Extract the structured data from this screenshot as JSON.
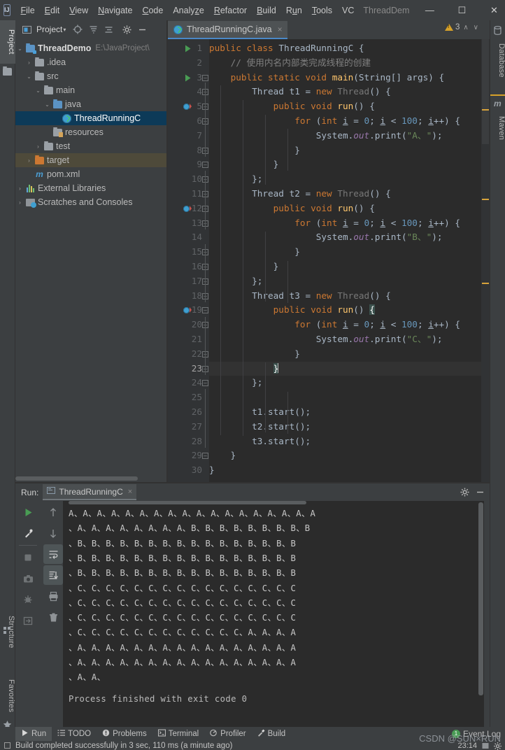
{
  "window": {
    "logo": "IJ",
    "project_label": "ThreadDem",
    "minimize": "—",
    "maximize": "☐",
    "close": "✕"
  },
  "menubar": {
    "items": [
      {
        "pre": "",
        "u": "F",
        "post": "ile"
      },
      {
        "pre": "",
        "u": "E",
        "post": "dit"
      },
      {
        "pre": "",
        "u": "V",
        "post": "iew"
      },
      {
        "pre": "",
        "u": "N",
        "post": "avigate"
      },
      {
        "pre": "",
        "u": "C",
        "post": "ode"
      },
      {
        "pre": "Analy",
        "u": "z",
        "post": "e"
      },
      {
        "pre": "",
        "u": "R",
        "post": "efactor"
      },
      {
        "pre": "",
        "u": "B",
        "post": "uild"
      },
      {
        "pre": "R",
        "u": "u",
        "post": "n"
      },
      {
        "pre": "",
        "u": "T",
        "post": "ools"
      },
      {
        "pre": "VC",
        "u": "",
        "post": ""
      }
    ]
  },
  "left_strip": {
    "project_tab": "Project",
    "structure_tab": "Structure",
    "favorites_tab": "Favorites"
  },
  "right_strip": {
    "database_tab": "Database",
    "maven_tab": "Maven"
  },
  "project_panel": {
    "title": "Project",
    "icons": [
      "locate-icon",
      "collapse-all-icon",
      "expand-all-icon",
      "settings-gear-icon",
      "hide-panel-icon"
    ],
    "tree": [
      {
        "indent": 0,
        "arrow": "⌄",
        "icon": "module-folder-icon",
        "label": "ThreadDemo",
        "bold": true,
        "hint": "E:\\JavaProject\\",
        "state": "normal"
      },
      {
        "indent": 1,
        "arrow": "›",
        "icon": "folder-icon",
        "label": ".idea",
        "bold": false,
        "hint": "",
        "state": "normal"
      },
      {
        "indent": 1,
        "arrow": "⌄",
        "icon": "folder-icon",
        "label": "src",
        "bold": false,
        "hint": "",
        "state": "normal"
      },
      {
        "indent": 2,
        "arrow": "⌄",
        "icon": "folder-icon",
        "label": "main",
        "bold": false,
        "hint": "",
        "state": "normal"
      },
      {
        "indent": 3,
        "arrow": "⌄",
        "icon": "source-folder-icon",
        "label": "java",
        "bold": false,
        "hint": "",
        "state": "normal"
      },
      {
        "indent": 4,
        "arrow": "",
        "icon": "java-class-icon",
        "label": "ThreadRunningC",
        "bold": false,
        "hint": "",
        "state": "selected"
      },
      {
        "indent": 3,
        "arrow": "",
        "icon": "resources-folder-icon",
        "label": "resources",
        "bold": false,
        "hint": "",
        "state": "normal"
      },
      {
        "indent": 2,
        "arrow": "›",
        "icon": "folder-icon",
        "label": "test",
        "bold": false,
        "hint": "",
        "state": "normal"
      },
      {
        "indent": 1,
        "arrow": "›",
        "icon": "excluded-folder-icon",
        "label": "target",
        "bold": false,
        "hint": "",
        "state": "highlighted"
      },
      {
        "indent": 1,
        "arrow": "",
        "icon": "maven-pom-icon",
        "label": "pom.xml",
        "bold": false,
        "hint": "",
        "state": "normal"
      },
      {
        "indent": 0,
        "arrow": "›",
        "icon": "external-libraries-icon",
        "label": "External Libraries",
        "bold": false,
        "hint": "",
        "state": "normal"
      },
      {
        "indent": 0,
        "arrow": "›",
        "icon": "scratches-icon",
        "label": "Scratches and Consoles",
        "bold": false,
        "hint": "",
        "state": "normal"
      }
    ]
  },
  "editor": {
    "tab": {
      "label": "ThreadRunningC.java",
      "icon": "java-class-icon",
      "close": "×"
    },
    "inspection": {
      "count": "3",
      "icon": "warning-triangle-icon",
      "up": "∧",
      "down": "∨"
    },
    "cursor_line": 23,
    "lines": [
      {
        "n": 1,
        "html": "<span class=\"kw\">public class</span> <span class=\"typ\">ThreadRunningC</span> {",
        "gutter_run": true,
        "fold": "",
        "bp": false
      },
      {
        "n": 2,
        "html": "    <span class=\"cmt\">// 使用内名内部类完成线程的创建</span>",
        "gutter_run": false,
        "fold": "",
        "bp": false
      },
      {
        "n": 3,
        "html": "    <span class=\"kw\">public static</span> <span class=\"kw\">void</span> <span class=\"mth\">main</span>(String[] args) {",
        "gutter_run": true,
        "fold": "minus",
        "bp": false
      },
      {
        "n": 4,
        "html": "        Thread t1 = <span class=\"kw\">new</span> <span class=\"dim\">Thread</span>() {",
        "gutter_run": false,
        "fold": "minus",
        "bp": false
      },
      {
        "n": 5,
        "html": "            <span class=\"kw\">public</span> <span class=\"kw\">void</span> <span class=\"mth\">run</span>() {",
        "gutter_run": false,
        "fold": "minus",
        "bp": true
      },
      {
        "n": 6,
        "html": "                <span class=\"kw\">for</span> (<span class=\"kw\">int</span> <span class=\"var-u\">i</span> = <span class=\"num\">0</span>; <span class=\"var-u\">i</span> &lt; <span class=\"num\">100</span>; <span class=\"var-u\">i</span>++) {",
        "gutter_run": false,
        "fold": "minus",
        "bp": false
      },
      {
        "n": 7,
        "html": "                    System.<span class=\"fld\">out</span>.print(<span class=\"str\">\"A、\"</span>);",
        "gutter_run": false,
        "fold": "",
        "bp": false
      },
      {
        "n": 8,
        "html": "                }",
        "gutter_run": false,
        "fold": "end",
        "bp": false
      },
      {
        "n": 9,
        "html": "            }",
        "gutter_run": false,
        "fold": "minus",
        "bp": false
      },
      {
        "n": 10,
        "html": "        };",
        "gutter_run": false,
        "fold": "end",
        "bp": false
      },
      {
        "n": 11,
        "html": "        Thread t2 = <span class=\"kw\">new</span> <span class=\"dim\">Thread</span>() {",
        "gutter_run": false,
        "fold": "minus",
        "bp": false
      },
      {
        "n": 12,
        "html": "            <span class=\"kw\">public</span> <span class=\"kw\">void</span> <span class=\"mth\">run</span>() {",
        "gutter_run": false,
        "fold": "end",
        "bp": true
      },
      {
        "n": 13,
        "html": "                <span class=\"kw\">for</span> (<span class=\"kw\">int</span> <span class=\"var-u\">i</span> = <span class=\"num\">0</span>; <span class=\"var-u\">i</span> &lt; <span class=\"num\">100</span>; <span class=\"var-u\">i</span>++) {",
        "gutter_run": false,
        "fold": "minus",
        "bp": false
      },
      {
        "n": 14,
        "html": "                    System.<span class=\"fld\">out</span>.print(<span class=\"str\">\"B、\"</span>);",
        "gutter_run": false,
        "fold": "",
        "bp": false
      },
      {
        "n": 15,
        "html": "                }",
        "gutter_run": false,
        "fold": "end",
        "bp": false
      },
      {
        "n": 16,
        "html": "            }",
        "gutter_run": false,
        "fold": "minus",
        "bp": false
      },
      {
        "n": 17,
        "html": "        };",
        "gutter_run": false,
        "fold": "end",
        "bp": false
      },
      {
        "n": 18,
        "html": "        Thread t3 = <span class=\"kw\">new</span> <span class=\"dim\">Thread</span>() {",
        "gutter_run": false,
        "fold": "minus",
        "bp": false
      },
      {
        "n": 19,
        "html": "            <span class=\"kw\">public</span> <span class=\"kw\">void</span> <span class=\"mth\">run</span>() <span class=\"brace-hi\">{</span>",
        "gutter_run": false,
        "fold": "end",
        "bp": true
      },
      {
        "n": 20,
        "html": "                <span class=\"kw\">for</span> (<span class=\"kw\">int</span> <span class=\"var-u\">i</span> = <span class=\"num\">0</span>; <span class=\"var-u\">i</span> &lt; <span class=\"num\">100</span>; <span class=\"var-u\">i</span>++) {",
        "gutter_run": false,
        "fold": "minus",
        "bp": false
      },
      {
        "n": 21,
        "html": "                    System.<span class=\"fld\">out</span>.print(<span class=\"str\">\"C、\"</span>);",
        "gutter_run": false,
        "fold": "",
        "bp": false
      },
      {
        "n": 22,
        "html": "                }",
        "gutter_run": false,
        "fold": "end",
        "bp": false
      },
      {
        "n": 23,
        "html": "            <span class=\"brace-hi\">}</span><span class=\"caret\"></span>",
        "gutter_run": false,
        "fold": "minus",
        "bp": false
      },
      {
        "n": 24,
        "html": "        };",
        "gutter_run": false,
        "fold": "end",
        "bp": false
      },
      {
        "n": 25,
        "html": "",
        "gutter_run": false,
        "fold": "",
        "bp": false
      },
      {
        "n": 26,
        "html": "        t1.start();",
        "gutter_run": false,
        "fold": "",
        "bp": false
      },
      {
        "n": 27,
        "html": "        t2.start();",
        "gutter_run": false,
        "fold": "",
        "bp": false
      },
      {
        "n": 28,
        "html": "        t3.start();",
        "gutter_run": false,
        "fold": "",
        "bp": false
      },
      {
        "n": 29,
        "html": "    }",
        "gutter_run": false,
        "fold": "end",
        "bp": false
      },
      {
        "n": 30,
        "html": "}",
        "gutter_run": false,
        "fold": "",
        "bp": false
      }
    ]
  },
  "run_panel": {
    "label": "Run:",
    "tab": {
      "label": "ThreadRunningC",
      "icon": "console-icon",
      "close": "×"
    },
    "header_icons": [
      "settings-gear-icon",
      "hide-panel-icon"
    ],
    "toolbar_left": [
      "rerun-icon",
      "rerun-failed-icon",
      "stop-icon",
      "screenshot-icon",
      "dump-threads-icon",
      "export-icon"
    ],
    "toolbar_right": [
      "scroll-up-icon",
      "scroll-down-icon",
      "soft-wrap-icon",
      "scroll-to-end-icon",
      "print-icon",
      "clear-all-icon"
    ],
    "console_lines": [
      "A、A、A、A、A、A、A、A、A、A、A、A、A、A、A、A、A、A",
      "、A、A、A、A、A、A、A、A、B、B、B、B、B、B、B、B、B",
      "、B、B、B、B、B、B、B、B、B、B、B、B、B、B、B、B",
      "、B、B、B、B、B、B、B、B、B、B、B、B、B、B、B、B",
      "、B、B、B、B、B、B、B、B、B、B、B、B、B、B、B、B",
      "、C、C、C、C、C、C、C、C、C、C、C、C、C、C、C、C",
      "、C、C、C、C、C、C、C、C、C、C、C、C、C、C、C、C",
      "、C、C、C、C、C、C、C、C、C、C、C、C、C、C、C、C",
      "、C、C、C、C、C、C、C、C、C、C、C、C、A、A、A、A",
      "、A、A、A、A、A、A、A、A、A、A、A、A、A、A、A、A",
      "、A、A、A、A、A、A、A、A、A、A、A、A、A、A、A、A",
      "、A、A、"
    ],
    "process_finished": "Process finished with exit code 0"
  },
  "tools_bar": {
    "items": [
      {
        "label": "Run",
        "icon": "play-icon",
        "active": true
      },
      {
        "label": "TODO",
        "icon": "todo-list-icon",
        "active": false
      },
      {
        "label": "Problems",
        "icon": "problems-icon",
        "active": false
      },
      {
        "label": "Terminal",
        "icon": "terminal-icon",
        "active": false
      },
      {
        "label": "Profiler",
        "icon": "profiler-icon",
        "active": false
      },
      {
        "label": "Build",
        "icon": "build-hammer-icon",
        "active": false
      }
    ],
    "event_log": {
      "label": "Event Log",
      "count": "1"
    }
  },
  "status_bar": {
    "message": "Build completed successfully in 3 sec, 110 ms (a minute ago)",
    "time": "23:14",
    "watermark": "CSDN @SUN×RUN"
  },
  "colors": {
    "accent": "#4a88c7",
    "editor_bg": "#2b2b2b",
    "panel_bg": "#3c3f41",
    "keyword": "#cc7832",
    "string": "#6a8759",
    "number": "#6897bb",
    "comment": "#808080",
    "method": "#ffc66d",
    "field": "#9876aa",
    "warning": "#d6a12a",
    "success": "#499c54",
    "selection": "#0d3a58"
  }
}
